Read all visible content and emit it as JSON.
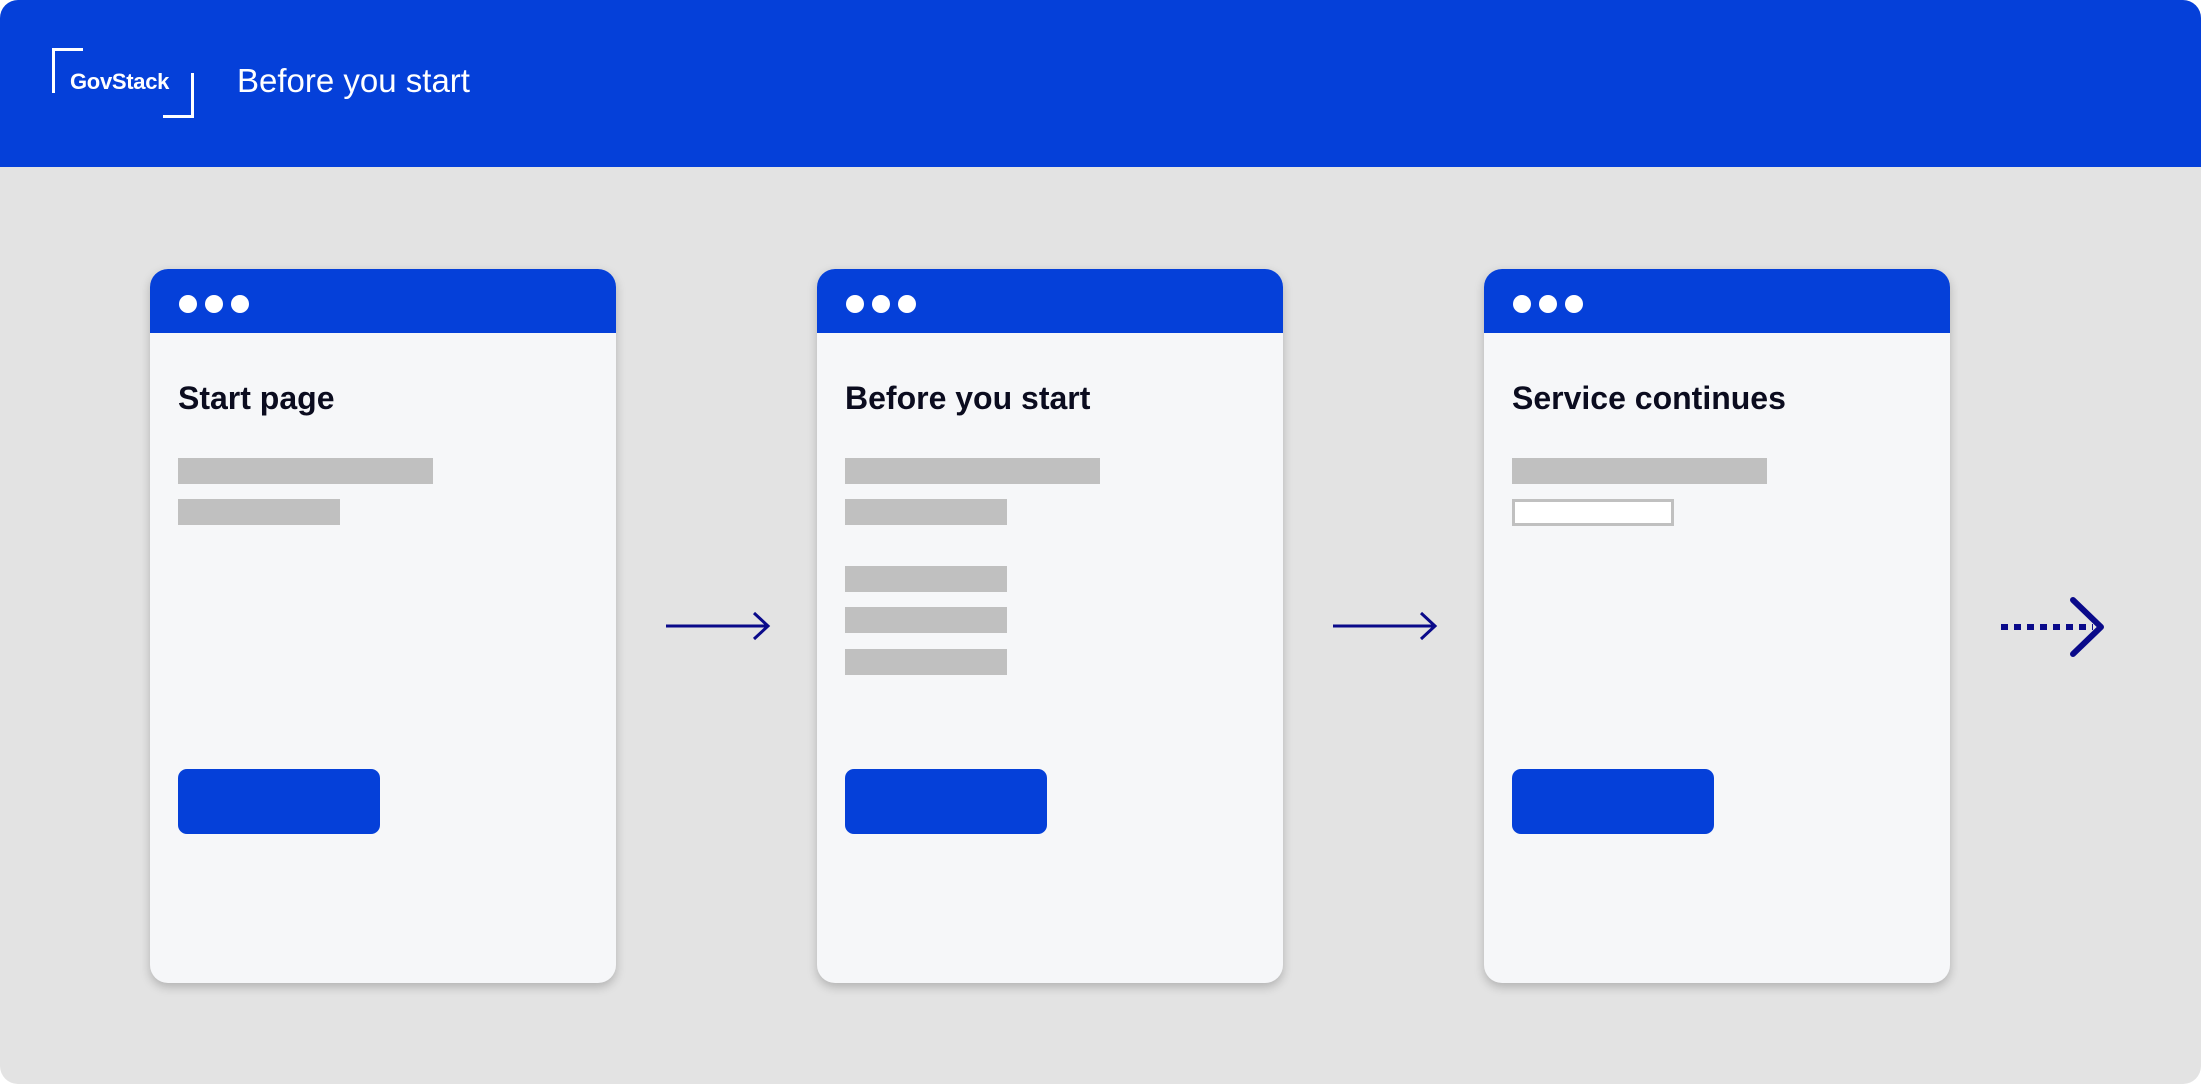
{
  "header": {
    "logo_text": "GovStack",
    "title": "Before you start"
  },
  "screens": [
    {
      "title": "Start page"
    },
    {
      "title": "Before you start"
    },
    {
      "title": "Service continues"
    }
  ],
  "colors": {
    "brand_blue": "#0540d9",
    "arrow_navy": "#0a0a8a",
    "placeholder_gray": "#c0c0c0",
    "background_gray": "#e3e3e3"
  }
}
